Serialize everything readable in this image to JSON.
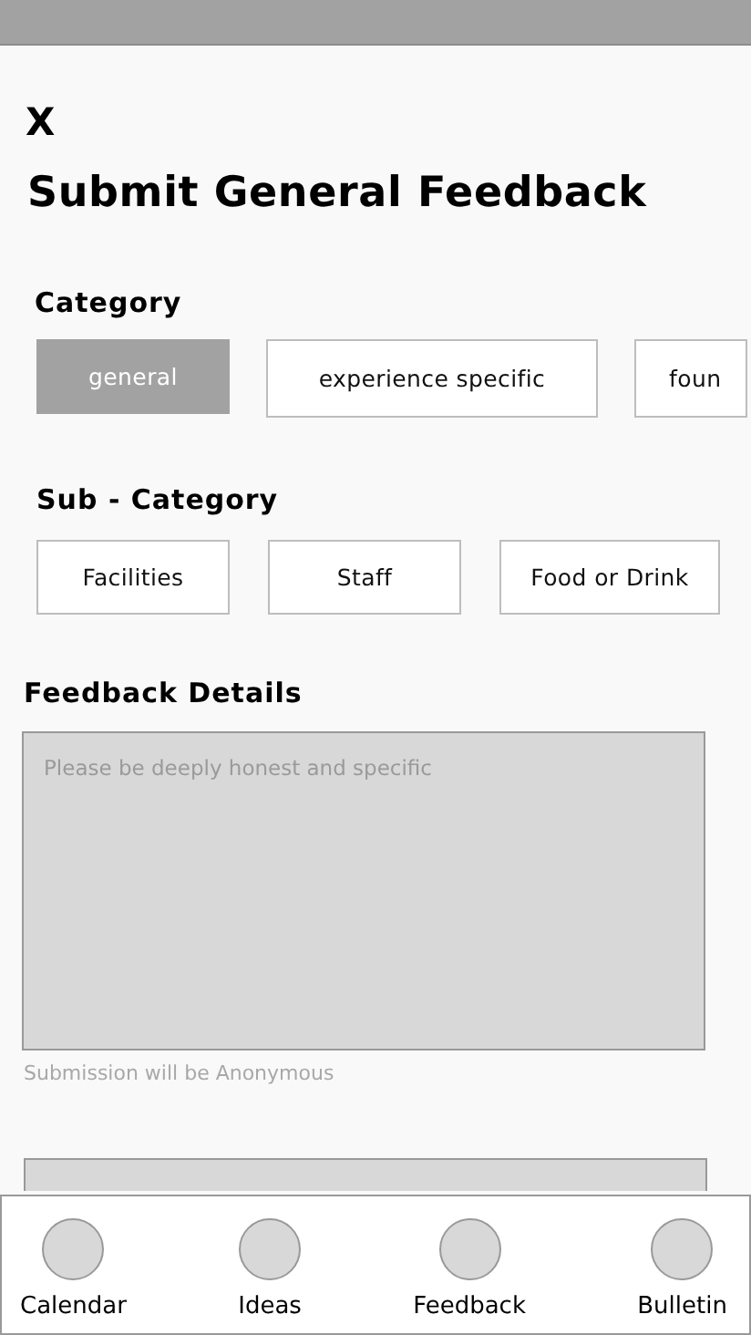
{
  "close": {
    "label": "X"
  },
  "title": "Submit General Feedback",
  "category": {
    "label": "Category",
    "options": [
      {
        "label": "general",
        "selected": true
      },
      {
        "label": "experience specific",
        "selected": false
      },
      {
        "label": "foun",
        "selected": false
      }
    ]
  },
  "sub_category": {
    "label": "Sub - Category",
    "options": [
      {
        "label": "Facilities",
        "selected": false
      },
      {
        "label": "Staff",
        "selected": false
      },
      {
        "label": "Food or Drink",
        "selected": false
      }
    ]
  },
  "details": {
    "label": "Feedback Details",
    "placeholder": "Please be deeply honest and specific",
    "note": "Submission will be Anonymous"
  },
  "nav": [
    {
      "label": "Calendar"
    },
    {
      "label": "Ideas"
    },
    {
      "label": "Feedback"
    },
    {
      "label": "Bulletin"
    }
  ]
}
